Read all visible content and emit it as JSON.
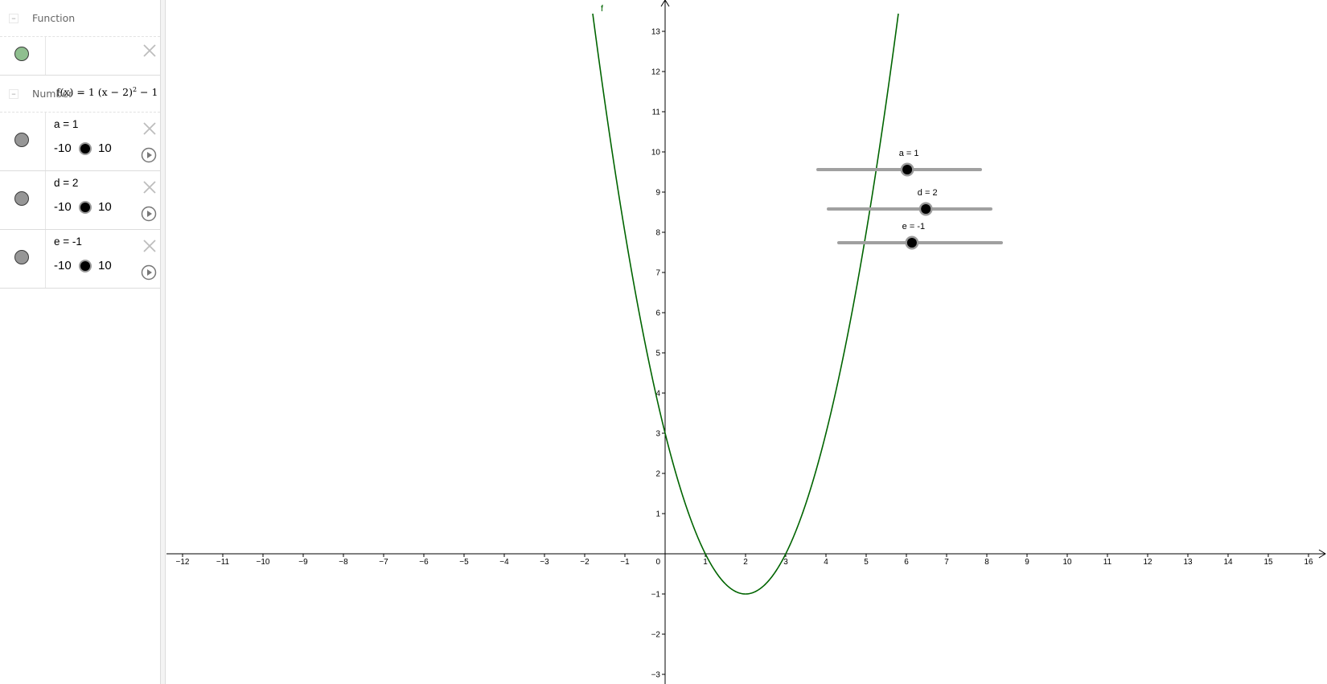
{
  "algebra": {
    "groups": [
      {
        "label": "Function"
      },
      {
        "label": "Number"
      }
    ],
    "function_item": {
      "definition_prefix": "f(x) = 1 (x − 2)",
      "exponent": "2",
      "definition_suffix": " − 1",
      "marble_color": "#8fbf8f"
    },
    "number_items": [
      {
        "label": "a = 1",
        "min": "-10",
        "max": "10"
      },
      {
        "label": "d = 2",
        "min": "-10",
        "max": "10"
      },
      {
        "label": "e = -1",
        "min": "-10",
        "max": "10"
      }
    ],
    "number_marble_color": "#969696"
  },
  "graphics": {
    "function_label": "f",
    "curve_color": "#006400",
    "x_ticks": [
      "−12",
      "−11",
      "−10",
      "−9",
      "−8",
      "−7",
      "−6",
      "−5",
      "−4",
      "−3",
      "−2",
      "−1",
      "1",
      "2",
      "3",
      "4",
      "5",
      "6",
      "7",
      "8",
      "9",
      "10",
      "11",
      "12",
      "13",
      "14",
      "15",
      "16"
    ],
    "y_ticks": [
      "−3",
      "−2",
      "−1",
      "1",
      "2",
      "3",
      "4",
      "5",
      "6",
      "7",
      "8",
      "9",
      "10",
      "11",
      "12",
      "13"
    ],
    "origin_label": "0",
    "sliders": [
      {
        "label": "a = 1",
        "value": 1,
        "min": -10,
        "max": 10
      },
      {
        "label": "d = 2",
        "value": 2,
        "min": -10,
        "max": 10
      },
      {
        "label": "e = -1",
        "value": -1,
        "min": -10,
        "max": 10
      }
    ],
    "function": {
      "a": 1,
      "d": 2,
      "e": -1
    }
  }
}
